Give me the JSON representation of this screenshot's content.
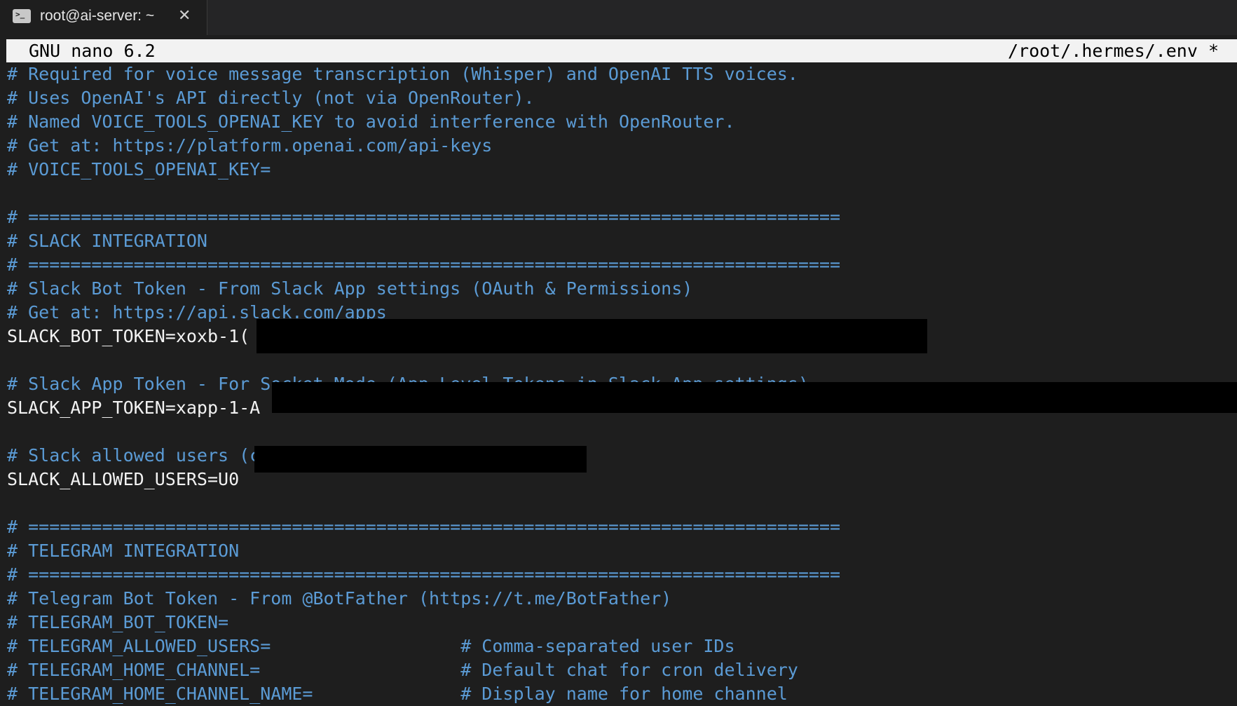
{
  "tab": {
    "title": "root@ai-server: ~",
    "close_glyph": "✕",
    "icon_glyph": ">_",
    "icon": "terminal-icon"
  },
  "editor": {
    "version": "GNU nano 6.2",
    "file_path": "/root/.hermes/.env *",
    "lines": [
      {
        "text": "# Required for voice message transcription (Whisper) and OpenAI TTS voices.",
        "kind": "comment"
      },
      {
        "text": "# Uses OpenAI's API directly (not via OpenRouter).",
        "kind": "comment"
      },
      {
        "text": "# Named VOICE_TOOLS_OPENAI_KEY to avoid interference with OpenRouter.",
        "kind": "comment"
      },
      {
        "text": "# Get at: https://platform.openai.com/api-keys",
        "kind": "comment"
      },
      {
        "text": "# VOICE_TOOLS_OPENAI_KEY=",
        "kind": "comment"
      },
      {
        "text": "",
        "kind": "blank"
      },
      {
        "text": "# =============================================================================",
        "kind": "comment"
      },
      {
        "text": "# SLACK INTEGRATION",
        "kind": "comment"
      },
      {
        "text": "# =============================================================================",
        "kind": "comment"
      },
      {
        "text": "# Slack Bot Token - From Slack App settings (OAuth & Permissions)",
        "kind": "comment"
      },
      {
        "text": "# Get at: https://api.slack.com/apps",
        "kind": "comment"
      },
      {
        "text": "SLACK_BOT_TOKEN=xoxb-1(",
        "kind": "plain"
      },
      {
        "text": "",
        "kind": "blank"
      },
      {
        "text": "# Slack App Token - For Socket Mode (App-Level Tokens in Slack App settings)",
        "kind": "comment"
      },
      {
        "text": "SLACK_APP_TOKEN=xapp-1-A",
        "kind": "plain"
      },
      {
        "text": "",
        "kind": "blank"
      },
      {
        "text": "# Slack allowed users (comma-separated Slack user IDs)",
        "kind": "comment"
      },
      {
        "text": "SLACK_ALLOWED_USERS=U0",
        "kind": "plain"
      },
      {
        "text": "",
        "kind": "blank"
      },
      {
        "text": "# =============================================================================",
        "kind": "comment"
      },
      {
        "text": "# TELEGRAM INTEGRATION",
        "kind": "comment"
      },
      {
        "text": "# =============================================================================",
        "kind": "comment"
      },
      {
        "text": "# Telegram Bot Token - From @BotFather (https://t.me/BotFather)",
        "kind": "comment"
      },
      {
        "text": "# TELEGRAM_BOT_TOKEN=",
        "kind": "comment"
      },
      {
        "text": "# TELEGRAM_ALLOWED_USERS=                  # Comma-separated user IDs",
        "kind": "comment"
      },
      {
        "text": "# TELEGRAM_HOME_CHANNEL=                   # Default chat for cron delivery",
        "kind": "comment"
      },
      {
        "text": "# TELEGRAM_HOME_CHANNEL_NAME=              # Display name for home channel",
        "kind": "comment"
      }
    ]
  },
  "colors": {
    "background": "#1e1e1e",
    "comment": "#5b9bd5",
    "plain": "#f2f2f2",
    "titlebar": "#f2f2f2"
  }
}
